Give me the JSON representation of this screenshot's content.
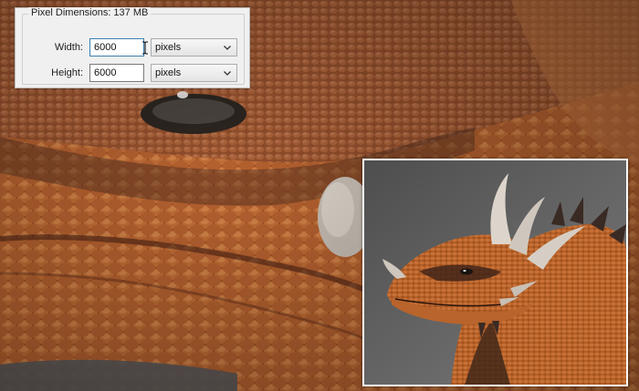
{
  "dialog": {
    "legend_label": "Pixel Dimensions:",
    "legend_value": "137 MB",
    "width": {
      "label": "Width:",
      "value": "6000",
      "unit": "pixels"
    },
    "height": {
      "label": "Height:",
      "value": "6000",
      "unit": "pixels"
    }
  },
  "colors": {
    "dialog_bg": "#f0f0f0",
    "scale_orange": "#b8622c",
    "inset_bg": "#5e5e5e"
  },
  "icons": {
    "dropdown": "chevron-down-icon",
    "cursor": "text-cursor-icon"
  }
}
